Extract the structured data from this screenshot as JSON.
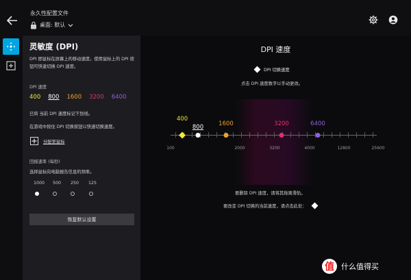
{
  "header": {
    "title": "永久性配置文件",
    "profile": "桌面: 默认"
  },
  "panel": {
    "title": "灵敏度 (DPI)",
    "description": "DPI 即鼠标在屏幕上的移动速度。使用鼠标上的 DPI 按钮可快速切换 DPI 速度。",
    "dpi_label": "DPI 速度",
    "dpi_values": [
      {
        "label": "400",
        "color": "#f0e83c"
      },
      {
        "label": "800",
        "color": "#ffffff",
        "selected": true
      },
      {
        "label": "1600",
        "color": "#f0a030"
      },
      {
        "label": "3200",
        "color": "#e0306a"
      },
      {
        "label": "6400",
        "color": "#9060e0"
      }
    ],
    "note_current": "已将 当前 DPI 速度标记下划线。",
    "note_switch": "在游戏中按住 DPI 切换按钮以快速切换速度。",
    "assign_label": "分配至鼠标",
    "rate_label": "回报速率 (每秒)",
    "rate_desc": "选择鼠标向电脑报告信息的频率。",
    "rates": [
      "1000",
      "500",
      "250",
      "125"
    ],
    "selected_rate": "1000",
    "reset_label": "恢复默认设置"
  },
  "main": {
    "title": "DPI 速度",
    "legend": "DPI 切换速度",
    "hint": "点击 DPI 速度数字以手动更改。",
    "note_delete": "要删除 DPI 速度，请将其拖离滑轨。",
    "note_change": "要改变 DPI 切换的当前速度，请点击此处："
  },
  "chart_data": {
    "type": "scatter",
    "x_ticks": [
      "100",
      "2000",
      "3200",
      "4000",
      "12800",
      "25600"
    ],
    "points": [
      {
        "label": "400",
        "color": "#f0e83c",
        "marker": "diamond"
      },
      {
        "label": "800",
        "color": "#ffffff",
        "marker": "circle",
        "selected": true
      },
      {
        "label": "1600",
        "color": "#f0a030",
        "marker": "circle"
      },
      {
        "label": "3200",
        "color": "#e0306a",
        "marker": "circle"
      },
      {
        "label": "6400",
        "color": "#9060e0",
        "marker": "circle"
      }
    ]
  },
  "watermark": {
    "logo": "值",
    "text": "什么值得买"
  }
}
